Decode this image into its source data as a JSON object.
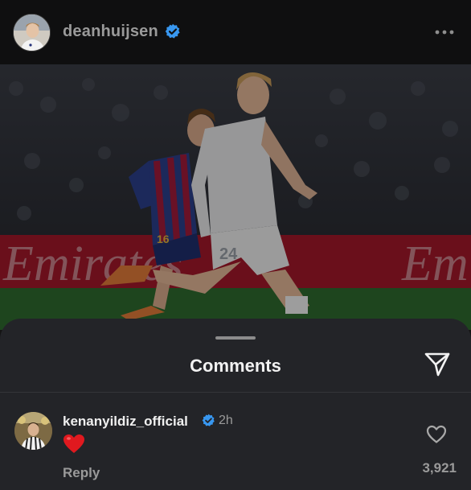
{
  "post": {
    "username": "deanhuijsen",
    "verified": true,
    "more_icon": "more-horizontal-icon"
  },
  "photo": {
    "description_icon": "football-match-photo",
    "sponsor_text": "Emirates",
    "player_number_white": "24",
    "player_number_blue": "16"
  },
  "comments_sheet": {
    "title": "Comments",
    "share_icon": "send-icon",
    "comment": {
      "username": "kenanyildiz_official",
      "verified": true,
      "time": "2h",
      "text_emoji": "red-heart-emoji",
      "reply_label": "Reply",
      "like_icon": "heart-outline-icon",
      "likes": "3,921"
    }
  },
  "colors": {
    "verified_blue": "#3897f0",
    "sheet_bg": "#232428",
    "header_bg": "#0f0f10",
    "heart_red": "#e0191f"
  }
}
